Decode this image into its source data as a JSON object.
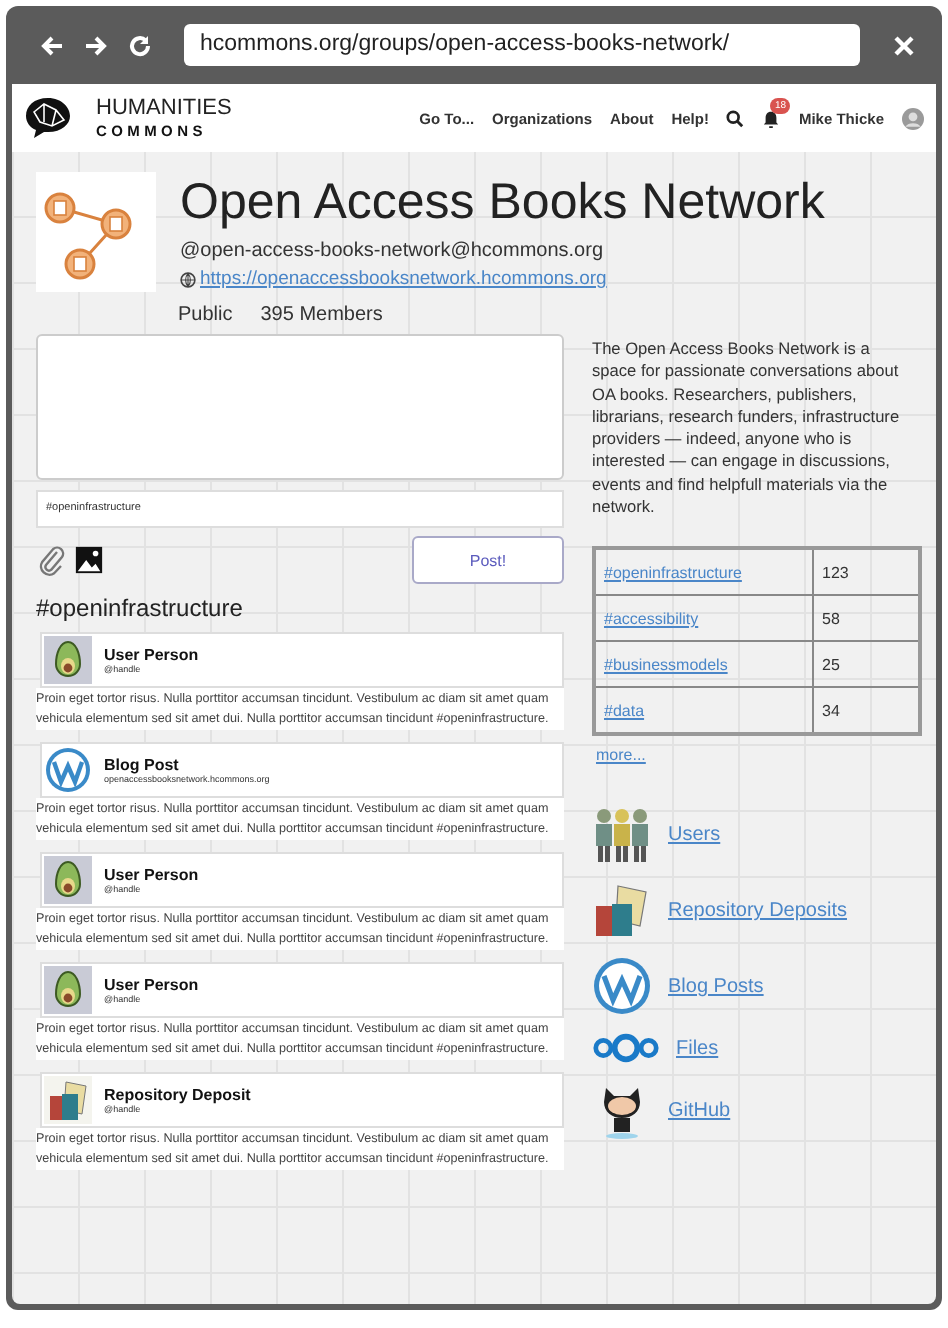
{
  "browser": {
    "url": "hcommons.org/groups/open-access-books-network/"
  },
  "nav": {
    "logo_top": "HUMANITIES",
    "logo_bottom": "COMMONS",
    "items": [
      "Go To...",
      "Organizations",
      "About",
      "Help!"
    ],
    "notification_count": "18",
    "user_name": "Mike Thicke"
  },
  "group": {
    "title": "Open Access Books Network",
    "email": "@open-access-books-network@hcommons.org",
    "url": "https://openaccessbooksnetwork.hcommons.org",
    "visibility": "Public",
    "members": "395 Members"
  },
  "composer": {
    "tag_value": "#openinfrastructure",
    "post_button": "Post!"
  },
  "feed": {
    "heading": "#openinfrastructure",
    "items": [
      {
        "kind": "user",
        "title": "User Person",
        "subtitle": "@handle",
        "body": "Proin eget tortor risus. Nulla porttitor accumsan tincidunt. Vestibulum ac diam sit amet quam vehicula elementum sed sit amet dui. Nulla porttitor accumsan tincidunt #openinfrastructure."
      },
      {
        "kind": "blog",
        "title": "Blog Post",
        "subtitle": "openaccessbooksnetwork.hcommons.org",
        "body": "Proin eget tortor risus. Nulla porttitor accumsan tincidunt. Vestibulum ac diam sit amet quam vehicula elementum sed sit amet dui. Nulla porttitor accumsan tincidunt #openinfrastructure."
      },
      {
        "kind": "user",
        "title": "User Person",
        "subtitle": "@handle",
        "body": "Proin eget tortor risus. Nulla porttitor accumsan tincidunt. Vestibulum ac diam sit amet quam vehicula elementum sed sit amet dui. Nulla porttitor accumsan tincidunt #openinfrastructure."
      },
      {
        "kind": "user",
        "title": "User Person",
        "subtitle": "@handle",
        "body": "Proin eget tortor risus. Nulla porttitor accumsan tincidunt. Vestibulum ac diam sit amet quam vehicula elementum sed sit amet dui. Nulla porttitor accumsan tincidunt #openinfrastructure."
      },
      {
        "kind": "deposit",
        "title": "Repository Deposit",
        "subtitle": "@handle",
        "body": "Proin eget tortor risus. Nulla porttitor accumsan tincidunt. Vestibulum ac diam sit amet quam vehicula elementum sed sit amet dui. Nulla porttitor accumsan tincidunt #openinfrastructure."
      }
    ]
  },
  "sidebar": {
    "description": "The Open Access Books Network is a space for passionate conversations about OA books. Researchers, publishers, librarians, research funders, infrastructure providers — indeed, anyone who is interested — can engage in discussions, events and find helpfull materials via the network.",
    "tags": [
      {
        "tag": "#openinfrastructure",
        "count": "123"
      },
      {
        "tag": "#accessibility",
        "count": "58"
      },
      {
        "tag": "#businessmodels",
        "count": "25"
      },
      {
        "tag": "#data",
        "count": "34"
      }
    ],
    "more": "more...",
    "links": [
      {
        "kind": "users",
        "label": "Users"
      },
      {
        "kind": "deposit",
        "label": "Repository Deposits"
      },
      {
        "kind": "blog",
        "label": "Blog Posts"
      },
      {
        "kind": "files",
        "label": "Files"
      },
      {
        "kind": "github",
        "label": "GitHub"
      }
    ]
  }
}
